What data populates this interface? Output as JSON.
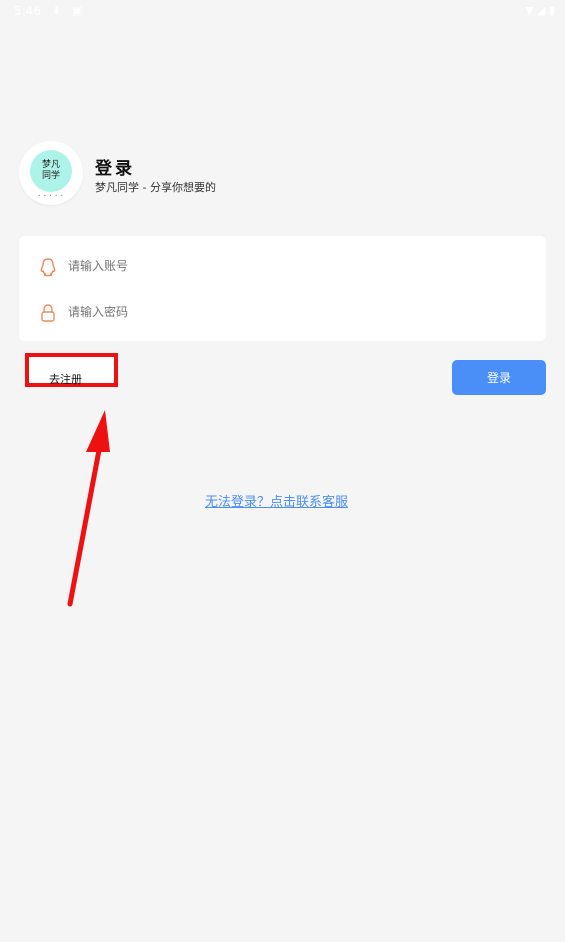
{
  "status_bar": {
    "time": "5:46",
    "left_icons": [
      "download-icon",
      "notification-icon"
    ],
    "right_icons": [
      "wifi-icon",
      "signal-icon",
      "battery-icon"
    ]
  },
  "header": {
    "logo_line1": "梦凡",
    "logo_line2": "同学",
    "title": "登录",
    "subtitle": "梦凡同学 - 分享你想要的"
  },
  "form": {
    "account_placeholder": "请输入账号",
    "password_placeholder": "请输入密码",
    "account_icon": "qq-icon",
    "password_icon": "lock-icon"
  },
  "actions": {
    "register_label": "去注册",
    "login_label": "登录"
  },
  "footer": {
    "help_link": "无法登录？点击联系客服"
  },
  "colors": {
    "accent": "#4a8ef7",
    "icon_orange": "#f08a5d",
    "highlight_red": "#ee1111",
    "background": "#f5f5f5"
  }
}
